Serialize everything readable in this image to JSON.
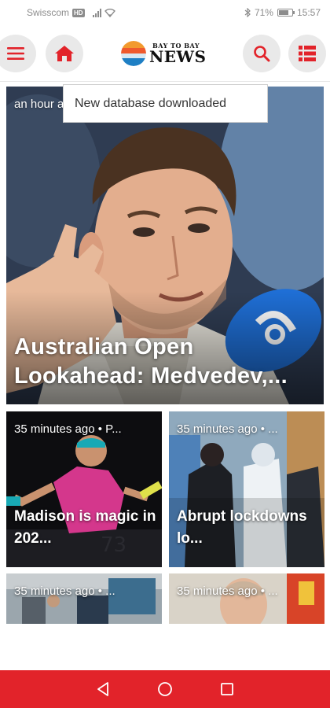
{
  "status_bar": {
    "carrier": "Swisscom",
    "network_badge": "HD",
    "battery": "71%",
    "time": "15:57",
    "icons": [
      "signal-icon",
      "wifi-icon",
      "bluetooth-icon",
      "battery-icon"
    ]
  },
  "header": {
    "logo_small": "BAY TO BAY",
    "logo_big": "NEWS",
    "accent_color": "#e2232a",
    "icons": [
      "menu-icon",
      "home-icon",
      "search-icon",
      "list-icon"
    ]
  },
  "toast": {
    "message": "New database downloaded"
  },
  "hero": {
    "time": "an hour ago",
    "title": "Australian Open Lookahead: Medvedev,..."
  },
  "cards": [
    {
      "time": "35 minutes ago • P...",
      "title": "Madison is magic in 202..."
    },
    {
      "time": "35 minutes ago • ...",
      "title": "Abrupt lockdowns lo..."
    },
    {
      "time": "35 minutes ago • ..."
    },
    {
      "time": "35 minutes ago • ..."
    }
  ],
  "nav_bar": {
    "color": "#e2232a",
    "icons": [
      "back-icon",
      "home-circle-icon",
      "recents-icon"
    ]
  }
}
